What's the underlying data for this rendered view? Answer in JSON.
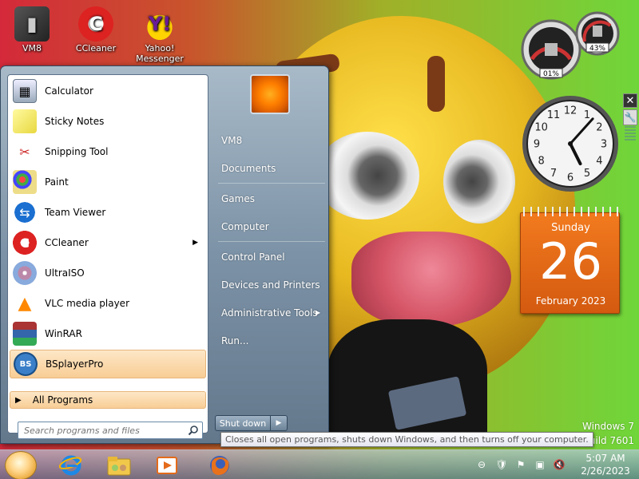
{
  "desktop": {
    "icons": [
      {
        "label": "VM8",
        "icon": "vm8-icon"
      },
      {
        "label": "CCleaner",
        "icon": "ccleaner-icon"
      },
      {
        "label": "Yahoo! Messenger",
        "icon": "yahoo-messenger-icon"
      }
    ],
    "watermark": {
      "line1": "Windows 7",
      "line2": "Build 7601"
    }
  },
  "gadgets": {
    "cpu_meter": {
      "cpu": "01%",
      "ram": "43%"
    },
    "clock": {
      "hour": 5,
      "minute": 7
    },
    "calendar": {
      "day_name": "Sunday",
      "day_number": "26",
      "month_year": "February 2023"
    }
  },
  "start_menu": {
    "programs": [
      {
        "label": "Calculator",
        "icon": "calculator-icon",
        "submenu": false
      },
      {
        "label": "Sticky Notes",
        "icon": "sticky-notes-icon",
        "submenu": false
      },
      {
        "label": "Snipping Tool",
        "icon": "scissors-icon",
        "submenu": false
      },
      {
        "label": "Paint",
        "icon": "paint-icon",
        "submenu": false
      },
      {
        "label": "Team Viewer",
        "icon": "teamviewer-icon",
        "submenu": false
      },
      {
        "label": "CCleaner",
        "icon": "ccleaner-icon",
        "submenu": true
      },
      {
        "label": "UltraISO",
        "icon": "disc-icon",
        "submenu": false
      },
      {
        "label": "VLC media player",
        "icon": "vlc-cone-icon",
        "submenu": false
      },
      {
        "label": "WinRAR",
        "icon": "winrar-icon",
        "submenu": false
      },
      {
        "label": "BSplayerPro",
        "icon": "bsplayer-icon",
        "submenu": false,
        "highlighted": true
      }
    ],
    "all_programs": "All Programs",
    "search_placeholder": "Search programs and files",
    "places": [
      {
        "label": "VM8",
        "submenu": false
      },
      {
        "label": "Documents",
        "submenu": false
      },
      {
        "label": "Games",
        "submenu": false
      },
      {
        "label": "Computer",
        "submenu": false
      },
      {
        "label": "Control Panel",
        "submenu": false
      },
      {
        "label": "Devices and Printers",
        "submenu": false
      },
      {
        "label": "Administrative Tools",
        "submenu": true
      },
      {
        "label": "Run...",
        "submenu": false
      }
    ],
    "shutdown_label": "Shut down",
    "shutdown_tooltip": "Closes all open programs, shuts down Windows, and then turns off your computer."
  },
  "taskbar": {
    "pinned": [
      {
        "name": "internet-explorer-icon"
      },
      {
        "name": "windows-explorer-icon"
      },
      {
        "name": "media-player-icon"
      },
      {
        "name": "firefox-icon"
      }
    ],
    "clock": {
      "time": "5:07 AM",
      "date": "2/26/2023"
    }
  }
}
